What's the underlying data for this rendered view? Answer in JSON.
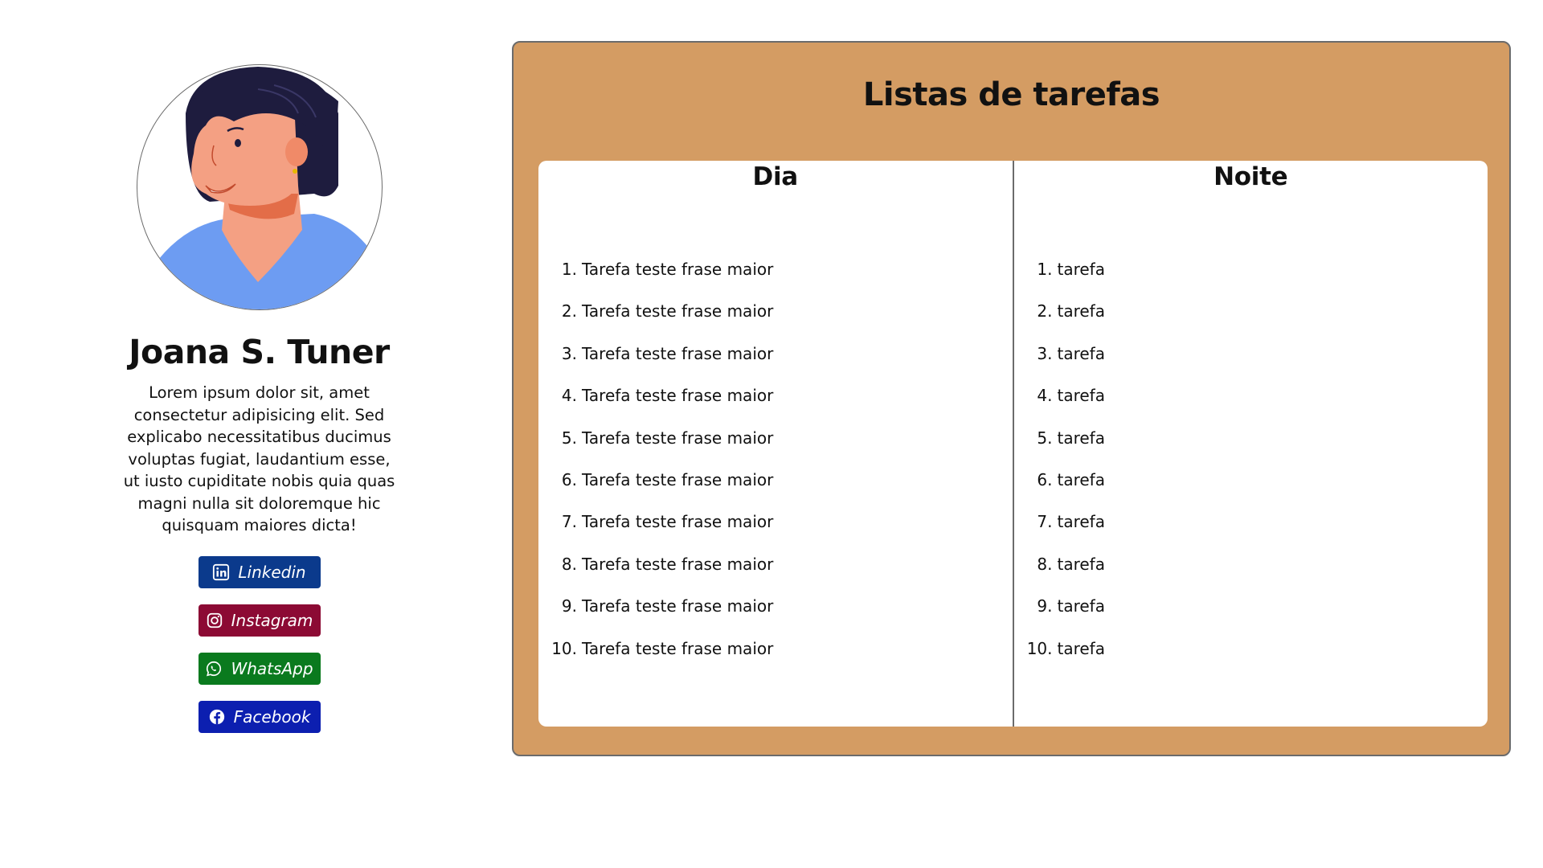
{
  "profile": {
    "avatar_icon": "woman-avatar-illustration",
    "name": "Joana S. Tuner",
    "bio": "Lorem ipsum dolor sit, amet consectetur adipisicing elit. Sed explicabo necessitatibus ducimus voluptas fugiat, laudantium esse, ut iusto cupiditate nobis quia quas magni nulla sit doloremque hic quisquam maiores dicta!",
    "socials": [
      {
        "label": "Linkedin",
        "icon": "linkedin-icon",
        "color": "#0b3a8c"
      },
      {
        "label": "Instagram",
        "icon": "instagram-icon",
        "color": "#8c0a34"
      },
      {
        "label": "WhatsApp",
        "icon": "whatsapp-icon",
        "color": "#0a7a1e"
      },
      {
        "label": "Facebook",
        "icon": "facebook-icon",
        "color": "#0c1fb0"
      }
    ]
  },
  "tasks": {
    "title": "Listas de tarefas",
    "card_color": "#d49c63",
    "day": {
      "title": "Dia",
      "items": [
        {
          "num": "1.",
          "text": "Tarefa teste frase maior"
        },
        {
          "num": "2.",
          "text": "Tarefa teste frase maior"
        },
        {
          "num": "3.",
          "text": "Tarefa teste frase maior"
        },
        {
          "num": "4.",
          "text": "Tarefa teste frase maior"
        },
        {
          "num": "5.",
          "text": "Tarefa teste frase maior"
        },
        {
          "num": "6.",
          "text": "Tarefa teste frase maior"
        },
        {
          "num": "7.",
          "text": "Tarefa teste frase maior"
        },
        {
          "num": "8.",
          "text": "Tarefa teste frase maior"
        },
        {
          "num": "9.",
          "text": "Tarefa teste frase maior"
        },
        {
          "num": "10.",
          "text": "Tarefa teste frase maior"
        }
      ]
    },
    "night": {
      "title": "Noite",
      "items": [
        {
          "num": "1.",
          "text": "tarefa"
        },
        {
          "num": "2.",
          "text": "tarefa"
        },
        {
          "num": "3.",
          "text": "tarefa"
        },
        {
          "num": "4.",
          "text": "tarefa"
        },
        {
          "num": "5.",
          "text": "tarefa"
        },
        {
          "num": "6.",
          "text": "tarefa"
        },
        {
          "num": "7.",
          "text": "tarefa"
        },
        {
          "num": "8.",
          "text": "tarefa"
        },
        {
          "num": "9.",
          "text": "tarefa"
        },
        {
          "num": "10.",
          "text": "tarefa"
        }
      ]
    }
  }
}
